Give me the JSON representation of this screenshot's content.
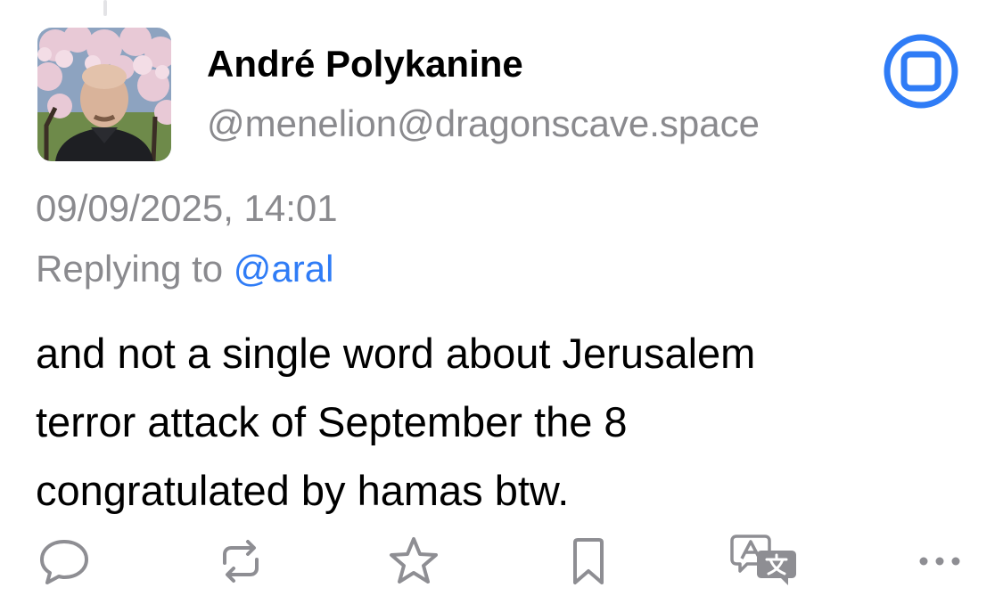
{
  "post": {
    "author": {
      "display_name": "André Polykanine",
      "handle": "@menelion@dragonscave.space"
    },
    "timestamp": "09/09/2025, 14:01",
    "reply": {
      "prefix": "Replying to ",
      "mention": "@aral"
    },
    "content_lines": [
      "and not a single word about Jerusalem",
      "terror attack of September the 8",
      "congratulated by hamas btw."
    ]
  },
  "actions": [
    {
      "name": "reply-icon"
    },
    {
      "name": "boost-icon"
    },
    {
      "name": "favourite-icon"
    },
    {
      "name": "bookmark-icon"
    },
    {
      "name": "translate-icon"
    },
    {
      "name": "more-icon"
    }
  ],
  "badge": {
    "name": "square-badge-icon"
  },
  "colors": {
    "accent": "#2f7cf6",
    "secondary_text": "#8a8a8e",
    "icon_gray": "#8e8e93"
  }
}
